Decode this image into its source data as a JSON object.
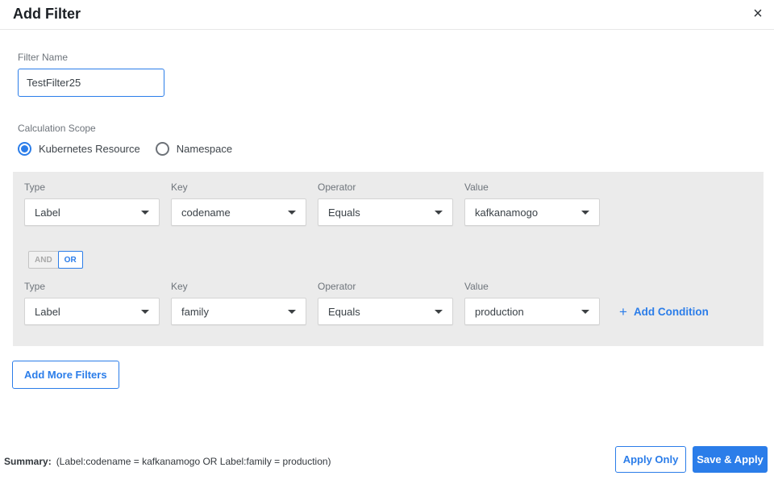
{
  "dialog": {
    "title": "Add Filter",
    "close_icon": "×"
  },
  "filter_name": {
    "label": "Filter Name",
    "value": "TestFilter25"
  },
  "calculation_scope": {
    "label": "Calculation Scope",
    "options": [
      {
        "label": "Kubernetes Resource",
        "selected": true
      },
      {
        "label": "Namespace",
        "selected": false
      }
    ]
  },
  "conditions": {
    "rows": [
      {
        "type_label": "Type",
        "type_value": "Label",
        "key_label": "Key",
        "key_value": "codename",
        "operator_label": "Operator",
        "operator_value": "Equals",
        "value_label": "Value",
        "value_value": "kafkanamogo"
      },
      {
        "type_label": "Type",
        "type_value": "Label",
        "key_label": "Key",
        "key_value": "family",
        "operator_label": "Operator",
        "operator_value": "Equals",
        "value_label": "Value",
        "value_value": "production"
      }
    ],
    "logic_toggle": {
      "and_label": "AND",
      "or_label": "OR",
      "selected": "OR"
    },
    "add_condition": {
      "plus_icon": "+",
      "label": "Add Condition"
    }
  },
  "actions": {
    "add_more_filters": "Add More Filters",
    "apply_only": "Apply Only",
    "save_and_apply": "Save & Apply"
  },
  "summary": {
    "label": "Summary:",
    "text": "(Label:codename = kafkanamogo OR Label:family = production)"
  },
  "colors": {
    "accent": "#2b7de9",
    "panel_bg": "#ebebeb",
    "selected_blue": "#2b7de9"
  }
}
